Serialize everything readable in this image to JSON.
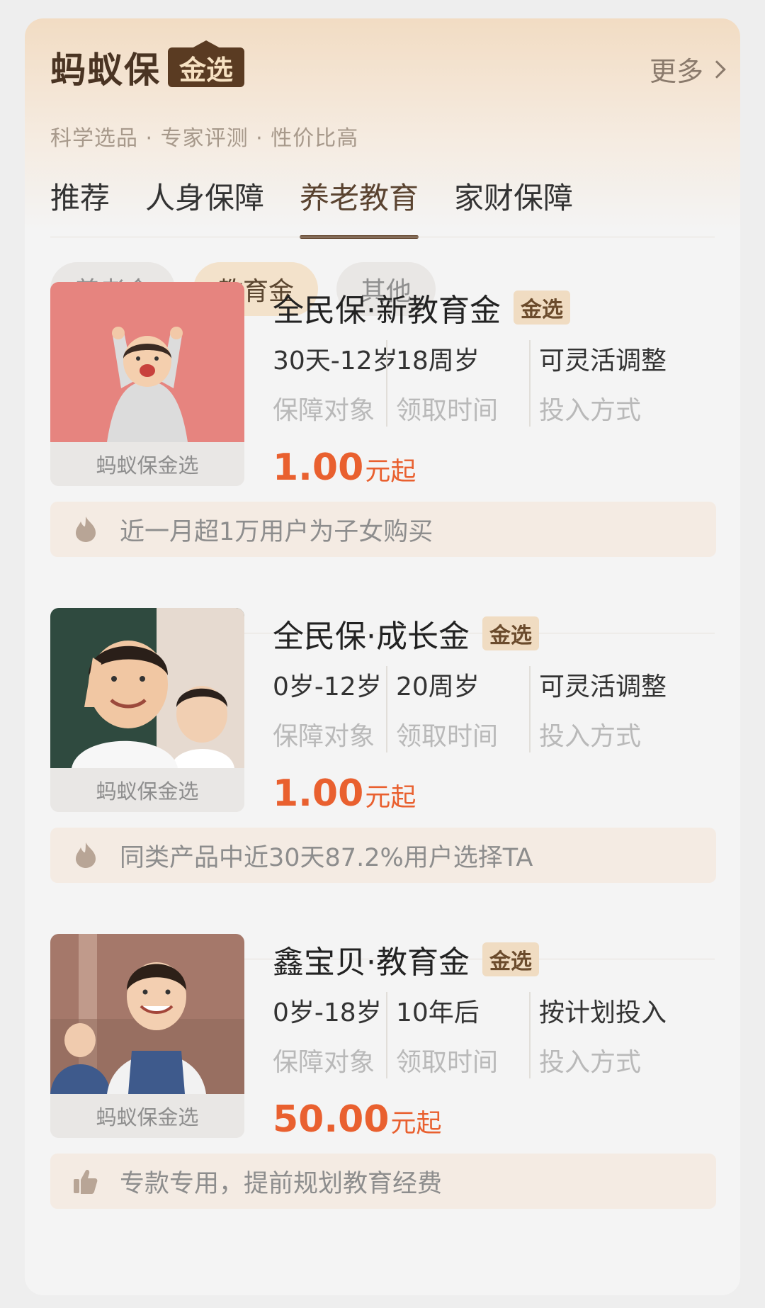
{
  "header": {
    "brand": "蚂蚁保",
    "brand_badge": "金选",
    "more_label": "更多",
    "tagline": "科学选品 · 专家评测 · 性价比高"
  },
  "tabs": [
    {
      "label": "推荐",
      "active": false
    },
    {
      "label": "人身保障",
      "active": false
    },
    {
      "label": "养老教育",
      "active": true
    },
    {
      "label": "家财保障",
      "active": false
    }
  ],
  "chips": [
    {
      "label": "养老金",
      "active": false
    },
    {
      "label": "教育金",
      "active": true
    },
    {
      "label": "其他",
      "active": false
    }
  ],
  "products": [
    {
      "name": "全民保·新教育金",
      "badge": "金选",
      "thumb_label": "蚂蚁保金选",
      "specs": [
        {
          "value": "30天-12岁",
          "key": "保障对象"
        },
        {
          "value": "18周岁",
          "key": "领取时间"
        },
        {
          "value": "可灵活调整",
          "key": "投入方式"
        }
      ],
      "price": "1.00",
      "price_unit": "元起",
      "hint_icon": "flame-icon",
      "hint": "近一月超1万用户为子女购买"
    },
    {
      "name": "全民保·成长金",
      "badge": "金选",
      "thumb_label": "蚂蚁保金选",
      "specs": [
        {
          "value": "0岁-12岁",
          "key": "保障对象"
        },
        {
          "value": "20周岁",
          "key": "领取时间"
        },
        {
          "value": "可灵活调整",
          "key": "投入方式"
        }
      ],
      "price": "1.00",
      "price_unit": "元起",
      "hint_icon": "flame-icon",
      "hint": "同类产品中近30天87.2%用户选择TA"
    },
    {
      "name": "鑫宝贝·教育金",
      "badge": "金选",
      "thumb_label": "蚂蚁保金选",
      "specs": [
        {
          "value": "0岁-18岁",
          "key": "保障对象"
        },
        {
          "value": "10年后",
          "key": "领取时间"
        },
        {
          "value": "按计划投入",
          "key": "投入方式"
        }
      ],
      "price": "50.00",
      "price_unit": "元起",
      "hint_icon": "thumbs-up-icon",
      "hint": "专款专用，提前规划教育经费"
    }
  ],
  "colors": {
    "accent_price": "#e9602f",
    "brand_brown": "#5a3b22",
    "badge_bg": "#f0dcc2"
  }
}
